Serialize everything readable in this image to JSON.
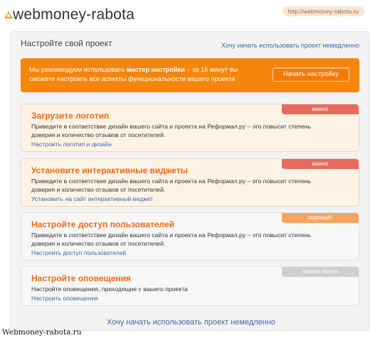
{
  "header": {
    "logo_text": "webmoney-rabota",
    "url": "http://webmoney-rabota.ru"
  },
  "panel": {
    "title": "Настройте свой проект",
    "top_link": "Хочу начать использовать проект немедленно"
  },
  "promo": {
    "text_before": "Мы рекомендуем использовать ",
    "text_bold": "мастер настройки",
    "text_after": " – за 15 минут вы сможете настроить все аспекты функциональности вашего проекта",
    "button_label": "Начать настройку"
  },
  "cards": [
    {
      "title": "Загрузите логотип",
      "description": "Приведите в соответствие дизайн вашего сайта и проекта на Реформал.ру – это повысит степень доверия и количество отзывов от посетителей.",
      "link": "Настроить логотип и дизайн",
      "badge": "важно",
      "badge_color": "#e86a5d"
    },
    {
      "title": "Установите интерактивные виджеты",
      "description": "Приведите в соответствие дизайн вашего сайта и проекта на Реформал.ру – это повысит степень доверия и количество отзывов от посетителей.",
      "link": "Установить на сайт интерактивный виджет",
      "badge": "важно",
      "badge_color": "#e86a5d"
    },
    {
      "title": "Настройте доступ пользователей",
      "description": "Приведите в соответствие дизайн вашего сайта и проекта на Реформал.ру – это повысит степень доверия и количество отзывов от посетителей.",
      "link": "Настроить доступ пользователей",
      "badge": "подождёт",
      "badge_color": "#f6a45f"
    },
    {
      "title": "Настройте оповещения",
      "description": "Настройте оповещения, приходящие с вашего проекта",
      "link": "Настроить оповещения",
      "badge": "можно потом",
      "badge_color": "#cfcfcf"
    }
  ],
  "bottom_link": "Хочу начать использовать проект немедленно",
  "footer_label": "Webmoney-rabota.ru",
  "colors": {
    "accent_orange": "#f5860b",
    "title_orange": "#ec6a17",
    "link_blue": "#3a6aa8"
  }
}
